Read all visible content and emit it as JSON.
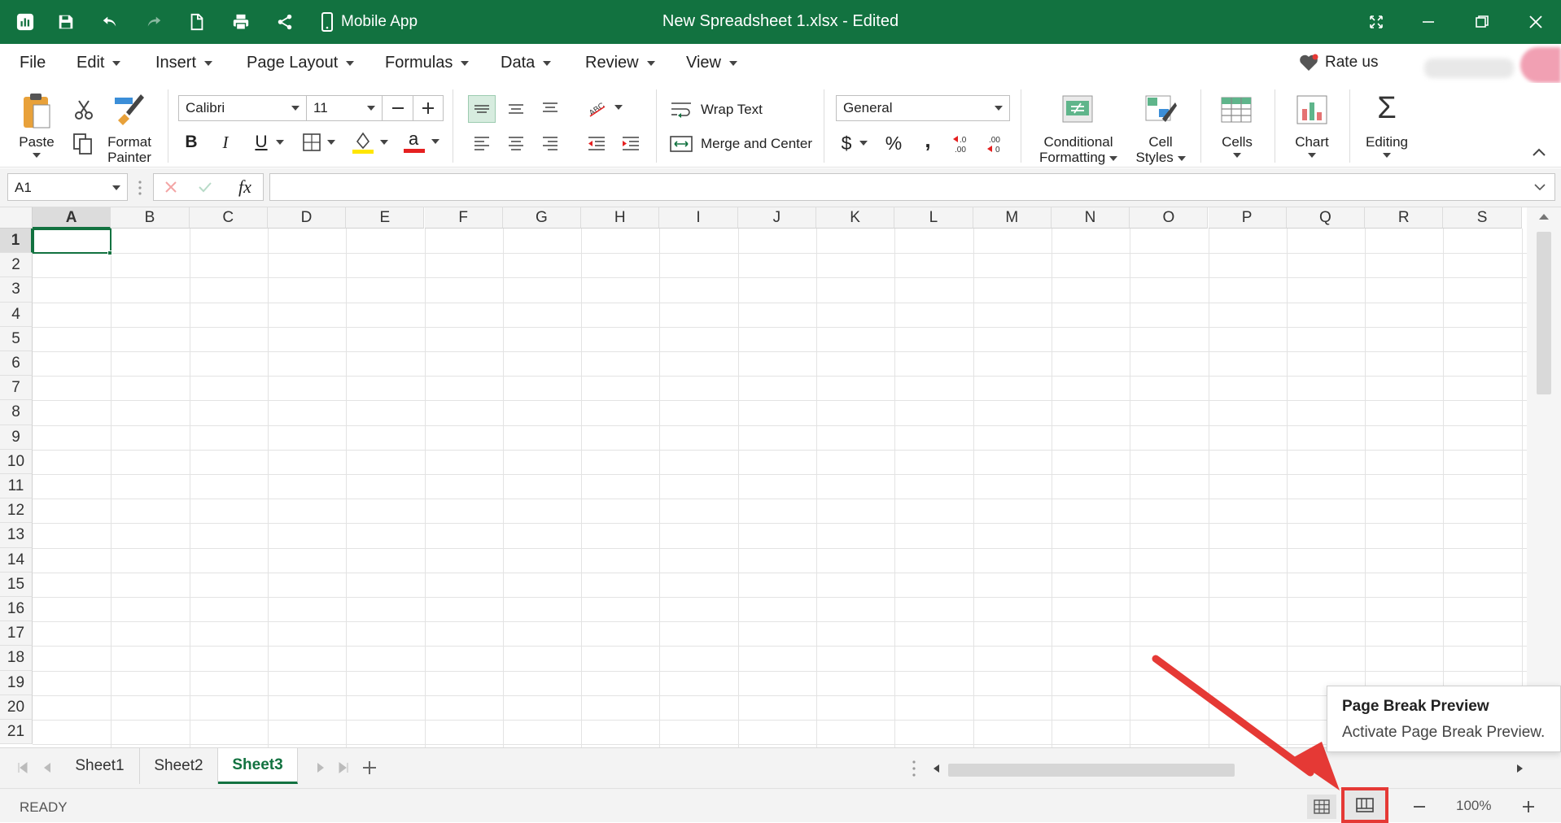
{
  "titlebar": {
    "title": "New Spreadsheet 1.xlsx - Edited",
    "mobile_app_label": "Mobile App",
    "bg_color": "#127240",
    "icons": [
      "app-logo-icon",
      "save-icon",
      "undo-icon",
      "redo-icon",
      "new-file-icon",
      "print-icon",
      "share-icon",
      "mobile-icon",
      "fullscreen-icon",
      "minimize-icon",
      "restore-icon",
      "close-icon"
    ]
  },
  "menu": {
    "items": [
      "File",
      "Edit",
      "Insert",
      "Page Layout",
      "Formulas",
      "Data",
      "Review",
      "View"
    ],
    "rate_us": "Rate us"
  },
  "ribbon": {
    "paste": "Paste",
    "format_painter_1": "Format",
    "format_painter_2": "Painter",
    "font_name": "Calibri",
    "font_size": "11",
    "wrap_text": "Wrap Text",
    "merge_center": "Merge and Center",
    "number_format": "General",
    "conditional_1": "Conditional",
    "conditional_2": "Formatting",
    "cell_styles_1": "Cell",
    "cell_styles_2": "Styles",
    "cells": "Cells",
    "chart": "Chart",
    "editing": "Editing",
    "currency": "$",
    "percent": "%",
    "comma": ","
  },
  "formula_bar": {
    "name_box": "A1",
    "fx": "fx",
    "formula_value": ""
  },
  "grid": {
    "columns": [
      "A",
      "B",
      "C",
      "D",
      "E",
      "F",
      "G",
      "H",
      "I",
      "J",
      "K",
      "L",
      "M",
      "N",
      "O",
      "P",
      "Q",
      "R",
      "S"
    ],
    "rows": [
      "1",
      "2",
      "3",
      "4",
      "5",
      "6",
      "7",
      "8",
      "9",
      "10",
      "11",
      "12",
      "13",
      "14",
      "15",
      "16",
      "17",
      "18",
      "19",
      "20",
      "21"
    ],
    "active_cell": "A1"
  },
  "sheets": {
    "tabs": [
      "Sheet1",
      "Sheet2",
      "Sheet3"
    ],
    "active": "Sheet3"
  },
  "status": {
    "state": "READY",
    "zoom": "100%"
  },
  "tooltip": {
    "title": "Page Break Preview",
    "description": "Activate Page Break Preview."
  },
  "colors": {
    "accent": "#127240",
    "highlight_yellow": "#ffe600",
    "font_red": "#e52020",
    "annotation_red": "#e53935"
  }
}
